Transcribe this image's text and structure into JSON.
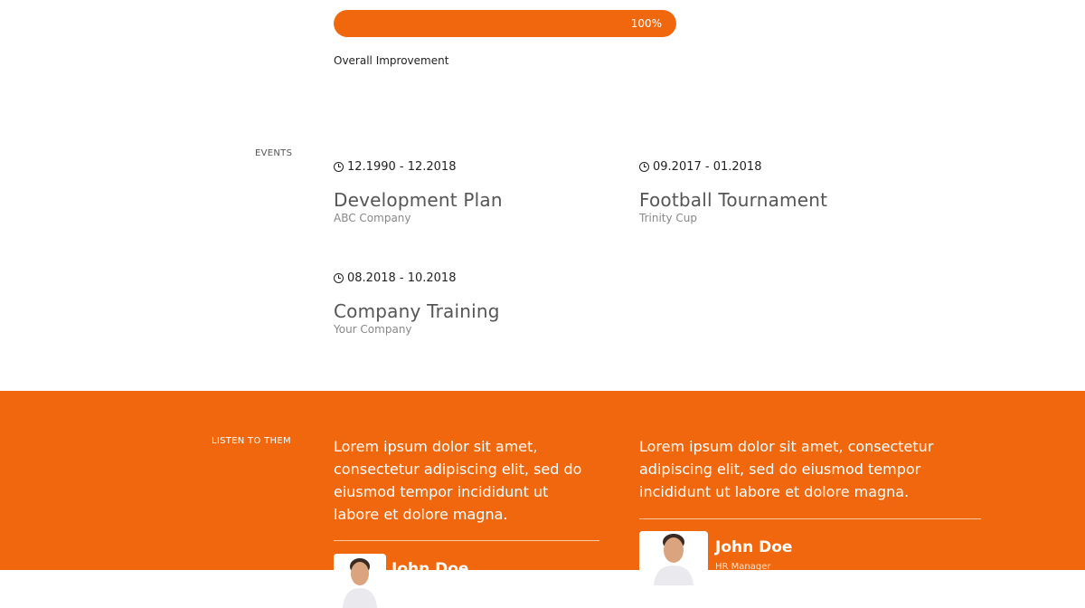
{
  "progress": {
    "label": "Overall Improvement",
    "value_text": "100%",
    "percent": 100
  },
  "events": {
    "section_label": "EVENTS",
    "items": [
      {
        "date": "12.1990 - 12.2018",
        "title": "Development Plan",
        "subtitle": "ABC Company"
      },
      {
        "date": "09.2017 - 01.2018",
        "title": "Football Tournament",
        "subtitle": "Trinity Cup"
      },
      {
        "date": "08.2018 - 10.2018",
        "title": "Company Training",
        "subtitle": "Your Company"
      }
    ]
  },
  "testimonials": {
    "section_label": "LISTEN TO THEM",
    "items": [
      {
        "quote": "Lorem ipsum dolor sit amet, consectetur adipiscing elit, sed do eiusmod tempor incididunt ut labore et dolore magna.",
        "name": "John Doe"
      },
      {
        "quote": "Lorem ipsum dolor sit amet, consectetur adipiscing elit, sed do eiusmod tempor incididunt ut labore et dolore magna.",
        "name": "John Doe",
        "role": "HR Manager"
      }
    ]
  },
  "colors": {
    "accent": "#f0670e"
  }
}
